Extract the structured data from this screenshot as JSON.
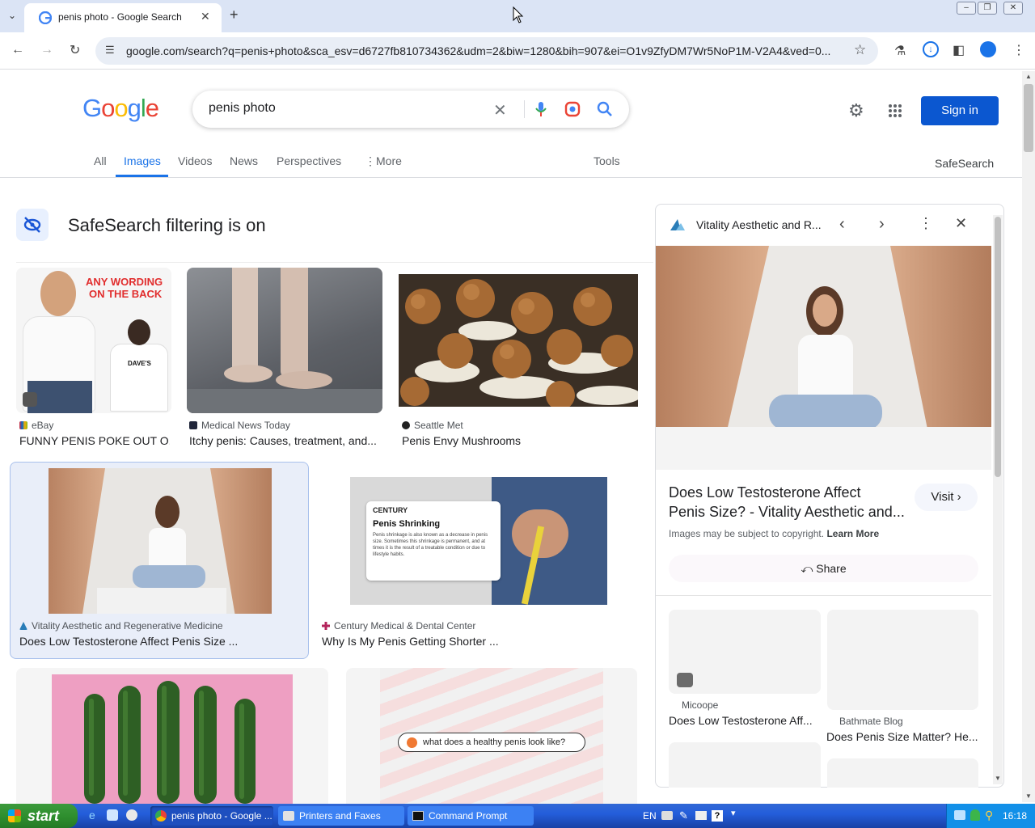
{
  "browser": {
    "tab_title": "penis photo - Google Search",
    "url": "google.com/search?q=penis+photo&sca_esv=d6727fb810734362&udm=2&biw=1280&bih=907&ei=O1v9ZfyDM7Wr5NoP1M-V2A4&ved=0..."
  },
  "header": {
    "query": "penis photo",
    "sign_in": "Sign in"
  },
  "nav": {
    "tabs": [
      "All",
      "Images",
      "Videos",
      "News",
      "Perspectives",
      "More"
    ],
    "tools": "Tools",
    "safesearch": "SafeSearch"
  },
  "safesearch_banner": "SafeSearch filtering is on",
  "results": [
    {
      "source": "eBay",
      "caption": "FUNNY PENIS POKE OUT O...",
      "overlay": [
        "ANY WORDING",
        "ON THE BACK",
        "DAVE'S"
      ]
    },
    {
      "source": "Medical News Today",
      "caption": "Itchy penis: Causes, treatment, and..."
    },
    {
      "source": "Seattle Met",
      "caption": "Penis Envy Mushrooms"
    },
    {
      "source": "Vitality Aesthetic and Regenerative Medicine",
      "caption": "Does Low Testosterone Affect Penis Size ..."
    },
    {
      "source": "Century Medical & Dental Center",
      "caption": "Why Is My Penis Getting Shorter ...",
      "card_brand": "CENTURY",
      "card_title": "Penis Shrinking",
      "card_body": "Penis shrinkage is also known as a decrease in penis size. Sometimes this shrinkage is permanent, and at times it is the result of a treatable condition or due to lifestyle habits."
    },
    {
      "source": "",
      "caption": "",
      "pill": "what does a healthy penis look like?"
    }
  ],
  "panel": {
    "site": "Vitality Aesthetic and R...",
    "title_line1": "Does Low Testosterone Affect",
    "title_line2": "Penis Size? - Vitality Aesthetic and...",
    "visit": "Visit",
    "copyright": "Images may be subject to copyright.",
    "learn_more": "Learn More",
    "share": "Share",
    "related": [
      {
        "source": "Micoope",
        "caption": "Does Low Testosterone Aff..."
      },
      {
        "source": "Bathmate Blog",
        "caption": "Does Penis Size Matter? He..."
      }
    ]
  },
  "taskbar": {
    "start": "start",
    "tasks": [
      "penis photo - Google ...",
      "Printers and Faxes",
      "Command Prompt"
    ],
    "lang": "EN",
    "clock": "16:18"
  },
  "colors": {
    "accent": "#0b57d0",
    "taskbar": "#245edb",
    "start": "#2f8f2f"
  }
}
